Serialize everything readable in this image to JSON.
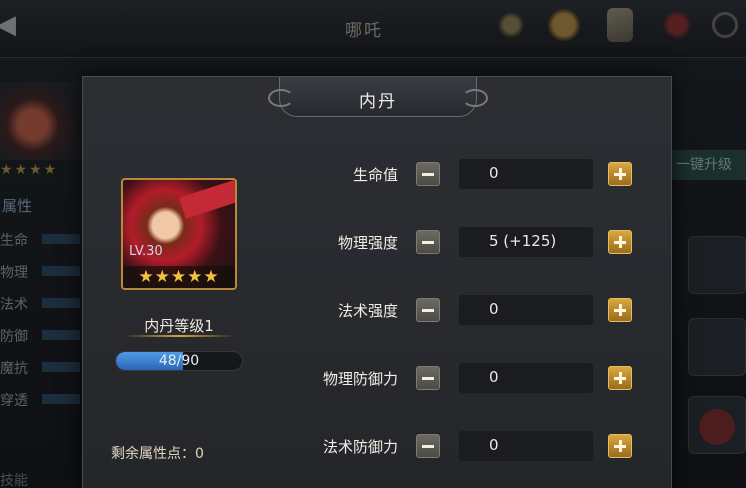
{
  "background": {
    "top_title": "哪吒",
    "right_button": "一键升级",
    "left_header": "属性",
    "left_rows": [
      "生命",
      "物理",
      "法术",
      "防御",
      "魔抗",
      "穿透"
    ],
    "left_footer": "技能",
    "icons": [
      "back-arrow-icon",
      "scroll-icon",
      "coin-icon",
      "map-icon",
      "rank-icon",
      "search-icon"
    ]
  },
  "modal": {
    "title": "内丹",
    "hero": {
      "level_text": "LV.30",
      "stars": "★★★★★",
      "star_count": 5
    },
    "core_level_label": "内丹等级1",
    "xp": {
      "text": "48/90",
      "current": 48,
      "max": 90
    },
    "points_label": "剩余属性点：",
    "points_value": "0",
    "stats": [
      {
        "label": "生命值",
        "value": "0"
      },
      {
        "label": "物理强度",
        "value": "5 (+125)"
      },
      {
        "label": "法术强度",
        "value": "0"
      },
      {
        "label": "物理防御力",
        "value": "0"
      },
      {
        "label": "法术防御力",
        "value": "0"
      }
    ]
  }
}
